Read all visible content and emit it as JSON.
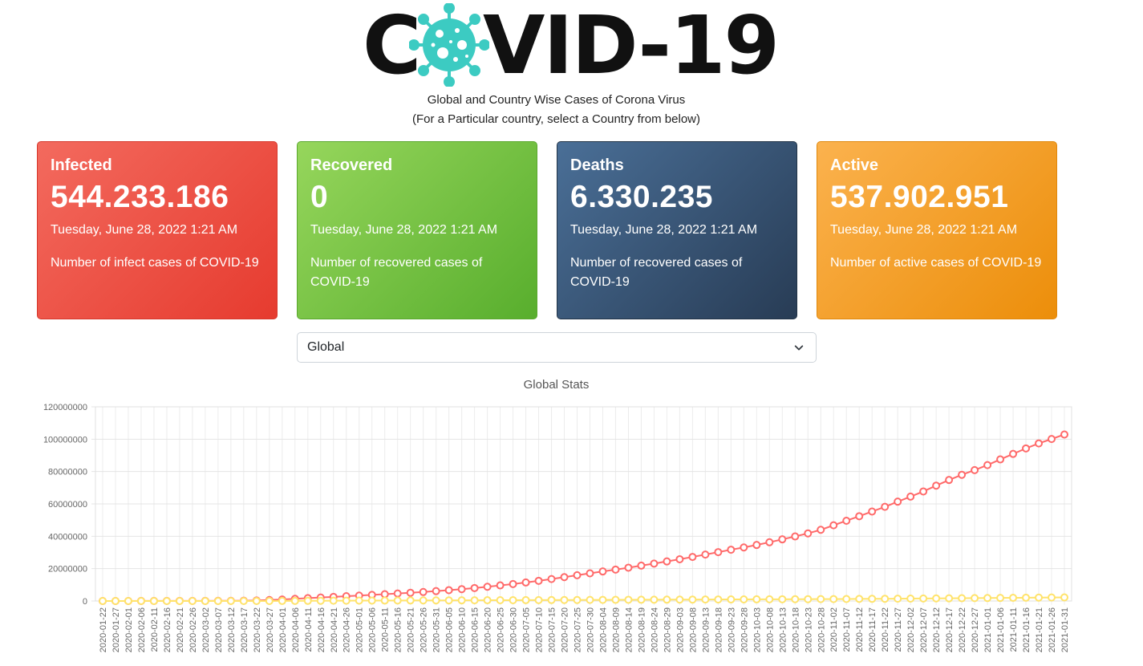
{
  "header": {
    "logo_left": "C",
    "logo_right": "VID-19",
    "logo_icon": "coronavirus-icon",
    "subtitle_1": "Global and Country Wise Cases of Corona Virus",
    "subtitle_2": "(For a Particular country, select a Country from below)"
  },
  "cards": {
    "infected": {
      "title": "Infected",
      "count": "544.233.186",
      "date": "Tuesday, June 28, 2022 1:21 AM",
      "desc": "Number of infect cases of COVID-19"
    },
    "recovered": {
      "title": "Recovered",
      "count": "0",
      "date": "Tuesday, June 28, 2022 1:21 AM",
      "desc": "Number of recovered cases of COVID-19"
    },
    "deaths": {
      "title": "Deaths",
      "count": "6.330.235",
      "date": "Tuesday, June 28, 2022 1:21 AM",
      "desc": "Number of recovered cases of COVID-19"
    },
    "active": {
      "title": "Active",
      "count": "537.902.951",
      "date": "Tuesday, June 28, 2022 1:21 AM",
      "desc": "Number of active cases of COVID-19"
    }
  },
  "country_select": {
    "value": "Global",
    "icon": "chevron-down-icon"
  },
  "colors": {
    "infected": "#f36a5e",
    "recovered": "#7ac943",
    "deaths": "#34506f",
    "active": "#f7a22e",
    "series_infected": "#ff6a6a",
    "series_deaths": "#ffe36b"
  },
  "chart_data": {
    "type": "line",
    "title": "Global Stats",
    "ylim": [
      0,
      120000000
    ],
    "yticks": [
      "120000000",
      "100000000",
      "80000000",
      "60000000",
      "40000000",
      "20000000",
      "0"
    ],
    "grid": true,
    "x": [
      "2020-01-22",
      "2020-01-27",
      "2020-02-01",
      "2020-02-06",
      "2020-02-11",
      "2020-02-16",
      "2020-02-21",
      "2020-02-26",
      "2020-03-02",
      "2020-03-07",
      "2020-03-12",
      "2020-03-17",
      "2020-03-22",
      "2020-03-27",
      "2020-04-01",
      "2020-04-06",
      "2020-04-11",
      "2020-04-16",
      "2020-04-21",
      "2020-04-26",
      "2020-05-01",
      "2020-05-06",
      "2020-05-11",
      "2020-05-16",
      "2020-05-21",
      "2020-05-26",
      "2020-05-31",
      "2020-06-05",
      "2020-06-10",
      "2020-06-15",
      "2020-06-20",
      "2020-06-25",
      "2020-06-30",
      "2020-07-05",
      "2020-07-10",
      "2020-07-15",
      "2020-07-20",
      "2020-07-25",
      "2020-07-30",
      "2020-08-04",
      "2020-08-09",
      "2020-08-14",
      "2020-08-19",
      "2020-08-24",
      "2020-08-29",
      "2020-09-03",
      "2020-09-08",
      "2020-09-13",
      "2020-09-18",
      "2020-09-23",
      "2020-09-28",
      "2020-10-03",
      "2020-10-08",
      "2020-10-13",
      "2020-10-18",
      "2020-10-23",
      "2020-10-28",
      "2020-11-02",
      "2020-11-07",
      "2020-11-12",
      "2020-11-17",
      "2020-11-22",
      "2020-11-27",
      "2020-12-02",
      "2020-12-07",
      "2020-12-12",
      "2020-12-17",
      "2020-12-22",
      "2020-12-27",
      "2021-01-01",
      "2021-01-06",
      "2021-01-11",
      "2021-01-16",
      "2021-01-21",
      "2021-01-26",
      "2021-01-31"
    ],
    "series": [
      {
        "values": [
          600,
          3000,
          12000,
          31000,
          44000,
          52000,
          78000,
          82000,
          89000,
          105000,
          127000,
          200000,
          336000,
          600000,
          930000,
          1340000,
          1770000,
          2160000,
          2560000,
          2970000,
          3350000,
          3770000,
          4200000,
          4640000,
          5100000,
          5560000,
          6110000,
          6720000,
          7330000,
          8010000,
          8790000,
          9640000,
          10500000,
          11450000,
          12480000,
          13580000,
          14750000,
          15930000,
          17120000,
          18270000,
          19420000,
          20600000,
          21860000,
          23110000,
          24460000,
          25800000,
          27240000,
          28700000,
          30200000,
          31700000,
          33100000,
          34630000,
          36300000,
          38100000,
          39900000,
          41800000,
          44000000,
          46800000,
          49600000,
          52400000,
          55300000,
          58200000,
          61400000,
          64500000,
          67700000,
          71300000,
          74800000,
          78000000,
          80900000,
          84000000,
          87500000,
          90900000,
          94300000,
          97400000,
          100100000,
          102900000
        ]
      },
      {
        "values": [
          17,
          82,
          259,
          565,
          1018,
          1665,
          2247,
          2763,
          3087,
          3511,
          4630,
          8000,
          14600,
          27000,
          47000,
          75000,
          110000,
          150000,
          181000,
          210000,
          236000,
          260000,
          290000,
          320000,
          345000,
          365000,
          378000,
          397000,
          418000,
          442000,
          466000,
          491000,
          511000,
          534000,
          563000,
          590000,
          614000,
          640000,
          672000,
          704000,
          730000,
          759000,
          789000,
          813000,
          839000,
          866000,
          890000,
          917000,
          946000,
          972000,
          1000000,
          1030000,
          1058000,
          1082000,
          1110000,
          1142000,
          1175000,
          1204000,
          1250000,
          1290000,
          1340000,
          1390000,
          1440000,
          1500000,
          1560000,
          1610000,
          1660000,
          1720000,
          1790000,
          1830000,
          1900000,
          1970000,
          2030000,
          2100000,
          2160000,
          2230000
        ]
      }
    ]
  }
}
